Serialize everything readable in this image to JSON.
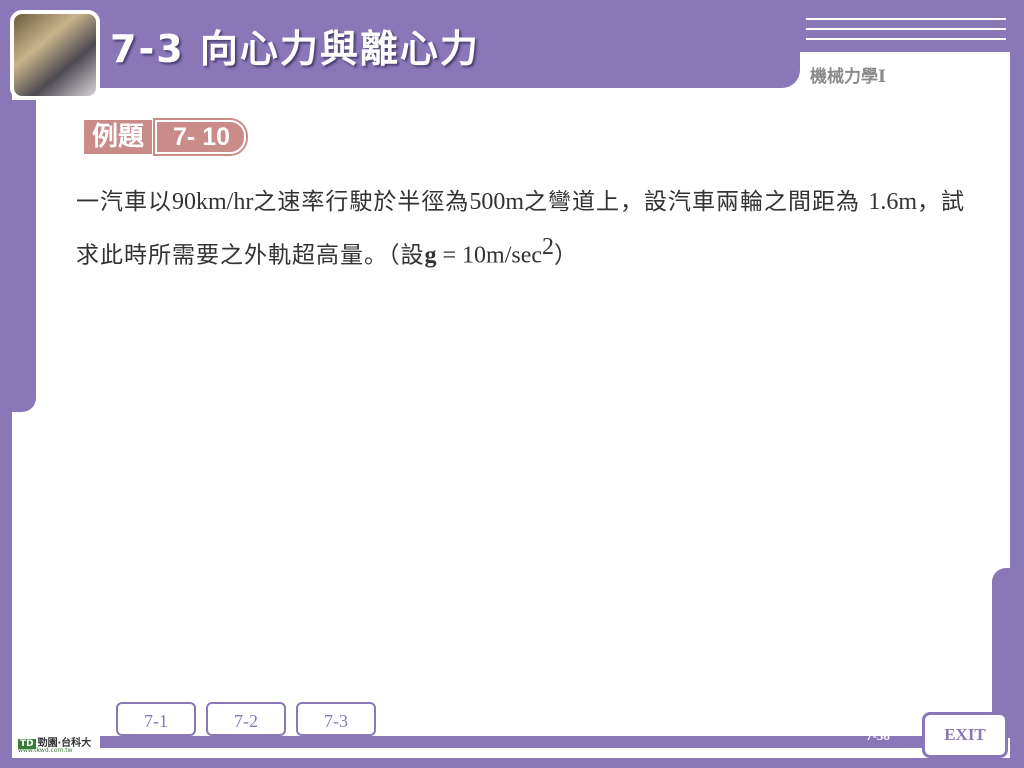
{
  "header": {
    "title": "7-3  向心力與離心力",
    "subject": "機械力學I"
  },
  "example": {
    "label": "例題",
    "number": "7- 10"
  },
  "problem": {
    "p1": "一汽車以",
    "v1": "90km/hr",
    "p2": "之速率行駛於半徑為",
    "v2": "500m",
    "p3": "之彎道上，設汽車兩輪之間距為",
    "v3": "1.6m",
    "p4": "，試求此時所需要之外軌超高量。（設",
    "g": "g",
    "eq": " = 10m/sec",
    "exp": "2",
    "p5": "）"
  },
  "nav": {
    "buttons": [
      "7-1",
      "7-2",
      "7-3"
    ]
  },
  "footer": {
    "page": "7-38",
    "exit": "EXIT",
    "logo_mark": "TD",
    "logo_text": "勁園‧台科大",
    "logo_url": "www.tkwd.com.tw"
  },
  "colors": {
    "frame": "#8a77b7",
    "example_badge": "#c98c88"
  }
}
